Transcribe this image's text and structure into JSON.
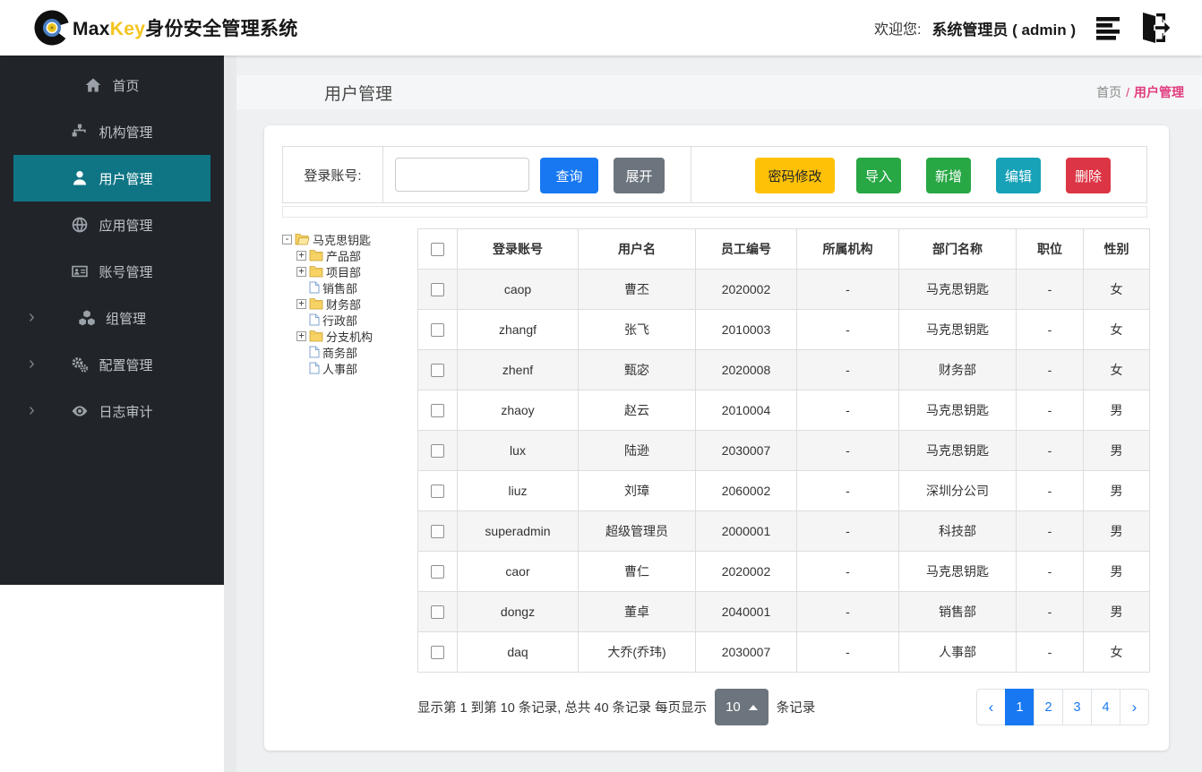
{
  "app": {
    "logo": {
      "max": "Max",
      "key": "Key",
      "suffix": "身份安全管理系统"
    },
    "welcome_label": "欢迎您:",
    "user_display": "系统管理员 ( admin )"
  },
  "sidebar": {
    "items": [
      {
        "id": "home",
        "label": "首页",
        "icon": "home",
        "active": false,
        "chevron": false
      },
      {
        "id": "org",
        "label": "机构管理",
        "icon": "sitemap",
        "active": false,
        "chevron": false
      },
      {
        "id": "user",
        "label": "用户管理",
        "icon": "user",
        "active": true,
        "chevron": false
      },
      {
        "id": "app",
        "label": "应用管理",
        "icon": "globe",
        "active": false,
        "chevron": false
      },
      {
        "id": "account",
        "label": "账号管理",
        "icon": "id-card",
        "active": false,
        "chevron": false
      },
      {
        "id": "group",
        "label": "组管理",
        "icon": "cubes",
        "active": false,
        "chevron": true
      },
      {
        "id": "config",
        "label": "配置管理",
        "icon": "gears",
        "active": false,
        "chevron": true
      },
      {
        "id": "audit",
        "label": "日志审计",
        "icon": "eye",
        "active": false,
        "chevron": true
      }
    ]
  },
  "page": {
    "title": "用户管理",
    "breadcrumb_home": "首页",
    "breadcrumb_sep": "/",
    "breadcrumb_current": "用户管理"
  },
  "filter": {
    "label": "登录账号:",
    "input_value": "",
    "query_label": "查询",
    "expand_label": "展开"
  },
  "toolbar": {
    "buttons": [
      {
        "name": "password-modify-button",
        "label": "密码修改",
        "bg": "#ffc107",
        "fg": "#212529"
      },
      {
        "name": "import-button",
        "label": "导入",
        "bg": "#28a745",
        "fg": "#ffffff"
      },
      {
        "name": "add-button",
        "label": "新增",
        "bg": "#28a745",
        "fg": "#ffffff"
      },
      {
        "name": "edit-button",
        "label": "编辑",
        "bg": "#17a2b8",
        "fg": "#ffffff"
      },
      {
        "name": "delete-button",
        "label": "删除",
        "bg": "#dc3545",
        "fg": "#ffffff"
      }
    ]
  },
  "tree": {
    "items": [
      {
        "label": "马克思钥匙",
        "level": 0,
        "toggle": "minus",
        "icon": "folder-open"
      },
      {
        "label": "产品部",
        "level": 1,
        "toggle": "plus",
        "icon": "folder"
      },
      {
        "label": "项目部",
        "level": 1,
        "toggle": "plus",
        "icon": "folder"
      },
      {
        "label": "销售部",
        "level": 1,
        "toggle": "none",
        "icon": "file"
      },
      {
        "label": "财务部",
        "level": 1,
        "toggle": "plus",
        "icon": "folder"
      },
      {
        "label": "行政部",
        "level": 1,
        "toggle": "none",
        "icon": "file"
      },
      {
        "label": "分支机构",
        "level": 1,
        "toggle": "plus",
        "icon": "folder"
      },
      {
        "label": "商务部",
        "level": 1,
        "toggle": "none",
        "icon": "file"
      },
      {
        "label": "人事部",
        "level": 1,
        "toggle": "none",
        "icon": "file"
      }
    ]
  },
  "table": {
    "columns": [
      "登录账号",
      "用户名",
      "员工编号",
      "所属机构",
      "部门名称",
      "职位",
      "性别"
    ],
    "rows": [
      [
        "caop",
        "曹丕",
        "2020002",
        "-",
        "马克思钥匙",
        "-",
        "女"
      ],
      [
        "zhangf",
        "张飞",
        "2010003",
        "-",
        "马克思钥匙",
        "-",
        "女"
      ],
      [
        "zhenf",
        "甄宓",
        "2020008",
        "-",
        "财务部",
        "-",
        "女"
      ],
      [
        "zhaoy",
        "赵云",
        "2010004",
        "-",
        "马克思钥匙",
        "-",
        "男"
      ],
      [
        "lux",
        "陆逊",
        "2030007",
        "-",
        "马克思钥匙",
        "-",
        "男"
      ],
      [
        "liuz",
        "刘璋",
        "2060002",
        "-",
        "深圳分公司",
        "-",
        "男"
      ],
      [
        "superadmin",
        "超级管理员",
        "2000001",
        "-",
        "科技部",
        "-",
        "男"
      ],
      [
        "caor",
        "曹仁",
        "2020002",
        "-",
        "马克思钥匙",
        "-",
        "男"
      ],
      [
        "dongz",
        "董卓",
        "2040001",
        "-",
        "销售部",
        "-",
        "男"
      ],
      [
        "daq",
        "大乔(乔玮)",
        "2030007",
        "-",
        "人事部",
        "-",
        "女"
      ]
    ]
  },
  "pagination": {
    "summary_prefix": "显示第 1 到第 10 条记录, 总共 40 条记录  每页显示",
    "page_size": "10",
    "summary_suffix": "条记录",
    "prev": "‹",
    "next": "›",
    "pages": [
      "1",
      "2",
      "3",
      "4"
    ],
    "active_page": "1"
  }
}
